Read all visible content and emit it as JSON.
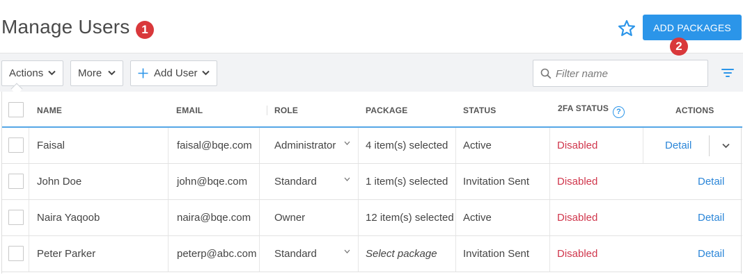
{
  "header": {
    "title": "Manage Users",
    "badge_1": "1",
    "badge_2": "2",
    "add_packages_label": "ADD PACKAGES",
    "favorite_icon": "star-icon",
    "accent_color": "#2b95e9"
  },
  "toolbar": {
    "actions_label": "Actions",
    "more_label": "More",
    "add_user_label": "Add User",
    "search_placeholder": "Filter name",
    "search_value": "",
    "filter_icon": "filter-icon"
  },
  "table": {
    "columns": {
      "name": "NAME",
      "email": "EMAIL",
      "role": "ROLE",
      "package": "PACKAGE",
      "status": "STATUS",
      "twofa": "2FA STATUS",
      "twofa_help": "?",
      "actions": "ACTIONS"
    },
    "rows": [
      {
        "name": "Faisal",
        "email": "faisal@bqe.com",
        "role": "Administrator",
        "package": "4 item(s) selected",
        "status": "Active",
        "twofa": "Disabled",
        "action": "Detail"
      },
      {
        "name": "John Doe",
        "email": "john@bqe.com",
        "role": "Standard",
        "package": "1 item(s) selected",
        "status": "Invitation Sent",
        "twofa": "Disabled",
        "action": "Detail"
      },
      {
        "name": "Naira Yaqoob",
        "email": "naira@bqe.com",
        "role": "Owner",
        "package": "12 item(s) selected",
        "status": "Active",
        "twofa": "Disabled",
        "action": "Detail"
      },
      {
        "name": "Peter Parker",
        "email": "peterp@abc.com",
        "role": "Standard",
        "package": "Select package",
        "status": "Invitation Sent",
        "twofa": "Disabled",
        "action": "Detail"
      }
    ]
  },
  "colors": {
    "disabled_status": "#d0364c",
    "link": "#2b86d8",
    "badge": "#d9383b"
  }
}
